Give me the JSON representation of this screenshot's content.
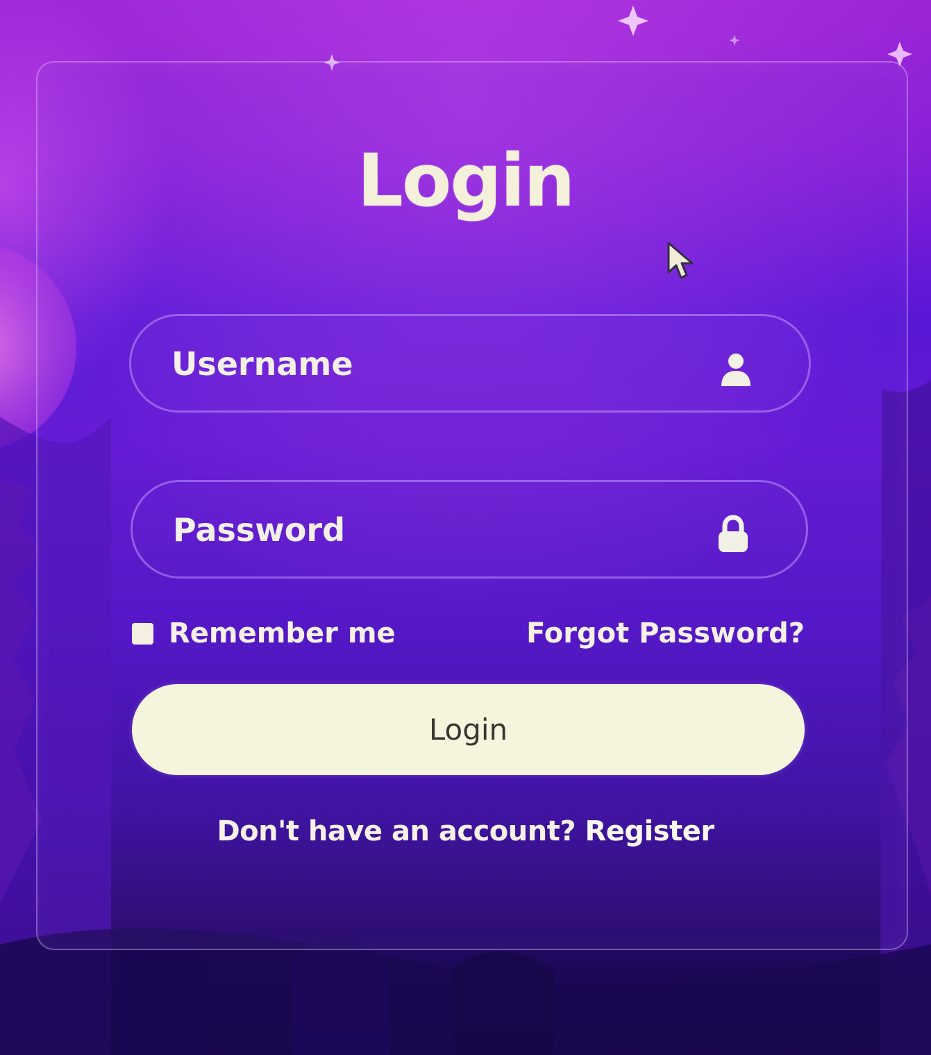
{
  "page": {
    "title": "Login"
  },
  "form": {
    "username": {
      "placeholder": "Username",
      "value": "",
      "icon": "user-icon"
    },
    "password": {
      "placeholder": "Password",
      "value": "",
      "icon": "lock-icon"
    },
    "remember_label": "Remember me",
    "remember_checked": false,
    "forgot_label": "Forgot Password?",
    "submit_label": "Login",
    "signup_prompt": "Don't have an account?",
    "register_label": "Register"
  },
  "colors": {
    "text": "#f5f1e6",
    "button_bg": "#f4f5dc",
    "button_text": "#3a3532",
    "accent_top": "#9b26d6",
    "accent_bottom": "#12053b"
  }
}
